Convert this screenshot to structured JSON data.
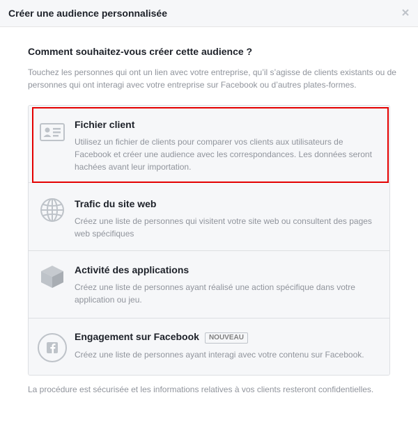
{
  "dialog": {
    "title": "Créer une audience personnalisée",
    "close_icon": "close-icon"
  },
  "question": "Comment souhaitez-vous créer cette audience ?",
  "intro": "Touchez les personnes qui ont un lien avec votre entreprise, qu’il s’agisse de clients existants ou de personnes qui ont interagi avec votre entreprise sur Facebook ou d’autres plates-formes.",
  "options": [
    {
      "title": "Fichier client",
      "description": "Utilisez un fichier de clients pour comparer vos clients aux utilisateurs de Facebook et créer une audience avec les correspondances. Les données seront hachées avant leur importation.",
      "icon": "id-card-icon",
      "selected": true
    },
    {
      "title": "Trafic du site web",
      "description": "Créez une liste de personnes qui visitent votre site web ou consultent des pages web spécifiques",
      "icon": "globe-icon"
    },
    {
      "title": "Activité des applications",
      "description": "Créez une liste de personnes ayant réalisé une action spécifique dans votre application ou jeu.",
      "icon": "cube-icon"
    },
    {
      "title": "Engagement sur Facebook",
      "badge": "NOUVEAU",
      "description": "Créez une liste de personnes ayant interagi avec votre contenu sur Facebook.",
      "icon": "facebook-icon"
    }
  ],
  "footer": "La procédure est sécurisée et les informations relatives à vos clients resteront confidentielles.",
  "colors": {
    "selection_border": "#e40000",
    "icon_gray": "#bec3c9",
    "text_primary": "#1d2129",
    "text_secondary": "#90949c"
  }
}
